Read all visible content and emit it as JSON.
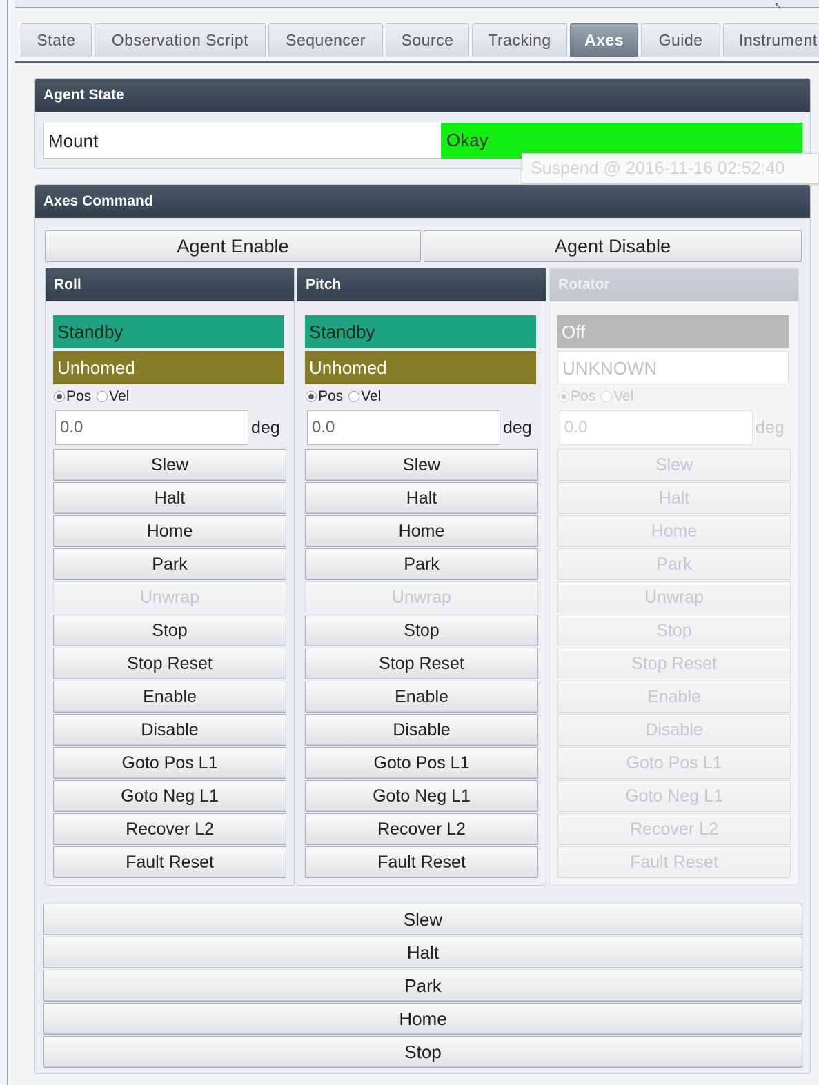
{
  "tabs": [
    "State",
    "Observation Script",
    "Sequencer",
    "Source",
    "Tracking",
    "Axes",
    "Guide",
    "Instrument"
  ],
  "agent_state": {
    "title": "Agent State",
    "agent_name": "Mount",
    "status": "Okay",
    "status_color": "#12ee12",
    "tooltip": "Suspend @ 2016-11-16 02:52:40"
  },
  "axes_command": {
    "title": "Axes Command",
    "enable_label": "Agent Enable",
    "disable_label": "Agent Disable",
    "axes": [
      {
        "name": "Roll",
        "state": "Standby",
        "home_state": "Unhomed",
        "mode_pos": "Pos",
        "mode_vel": "Vel",
        "value": "0.0",
        "unit": "deg",
        "buttons": [
          "Slew",
          "Halt",
          "Home",
          "Park",
          "Unwrap",
          "Stop",
          "Stop Reset",
          "Enable",
          "Disable",
          "Goto Pos L1",
          "Goto Neg L1",
          "Recover L2",
          "Fault Reset"
        ]
      },
      {
        "name": "Pitch",
        "state": "Standby",
        "home_state": "Unhomed",
        "mode_pos": "Pos",
        "mode_vel": "Vel",
        "value": "0.0",
        "unit": "deg",
        "buttons": [
          "Slew",
          "Halt",
          "Home",
          "Park",
          "Unwrap",
          "Stop",
          "Stop Reset",
          "Enable",
          "Disable",
          "Goto Pos L1",
          "Goto Neg L1",
          "Recover L2",
          "Fault Reset"
        ]
      },
      {
        "name": "Rotator",
        "state": "Off",
        "home_state": "UNKNOWN",
        "mode_pos": "Pos",
        "mode_vel": "Vel",
        "value": "0.0",
        "unit": "deg",
        "buttons": [
          "Slew",
          "Halt",
          "Home",
          "Park",
          "Unwrap",
          "Stop",
          "Stop Reset",
          "Enable",
          "Disable",
          "Goto Pos L1",
          "Goto Neg L1",
          "Recover L2",
          "Fault Reset"
        ]
      }
    ],
    "global_buttons": [
      "Slew",
      "Halt",
      "Park",
      "Home",
      "Stop"
    ]
  }
}
